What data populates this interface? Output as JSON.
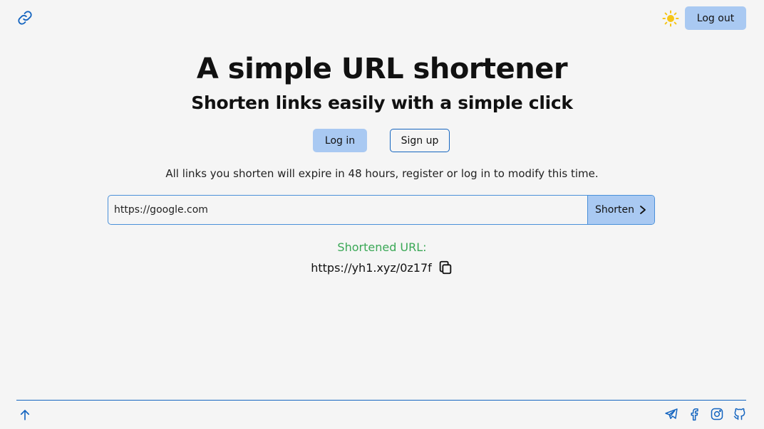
{
  "header": {
    "logo_icon": "link-icon",
    "theme_icon": "sun-icon",
    "logout_label": "Log out"
  },
  "hero": {
    "title": "A simple URL shortener",
    "subtitle": "Shorten links easily with a simple click"
  },
  "auth": {
    "login_label": "Log in",
    "signup_label": "Sign up"
  },
  "notice": "All links you shorten will expire in 48 hours, register or log in to modify this time.",
  "form": {
    "input_value": "https://google.com",
    "shorten_label": "Shorten"
  },
  "result": {
    "label": "Shortened URL:",
    "url": "https://yh1.xyz/0z17f"
  },
  "footer": {
    "up_icon": "arrow-up-icon",
    "socials": [
      "telegram-icon",
      "facebook-icon",
      "instagram-icon",
      "github-icon"
    ]
  },
  "colors": {
    "background": "#f5f5f5",
    "accent": "#1565c0",
    "button": "#a9c9f2",
    "success": "#3aa856",
    "sun": "#f5c518"
  }
}
